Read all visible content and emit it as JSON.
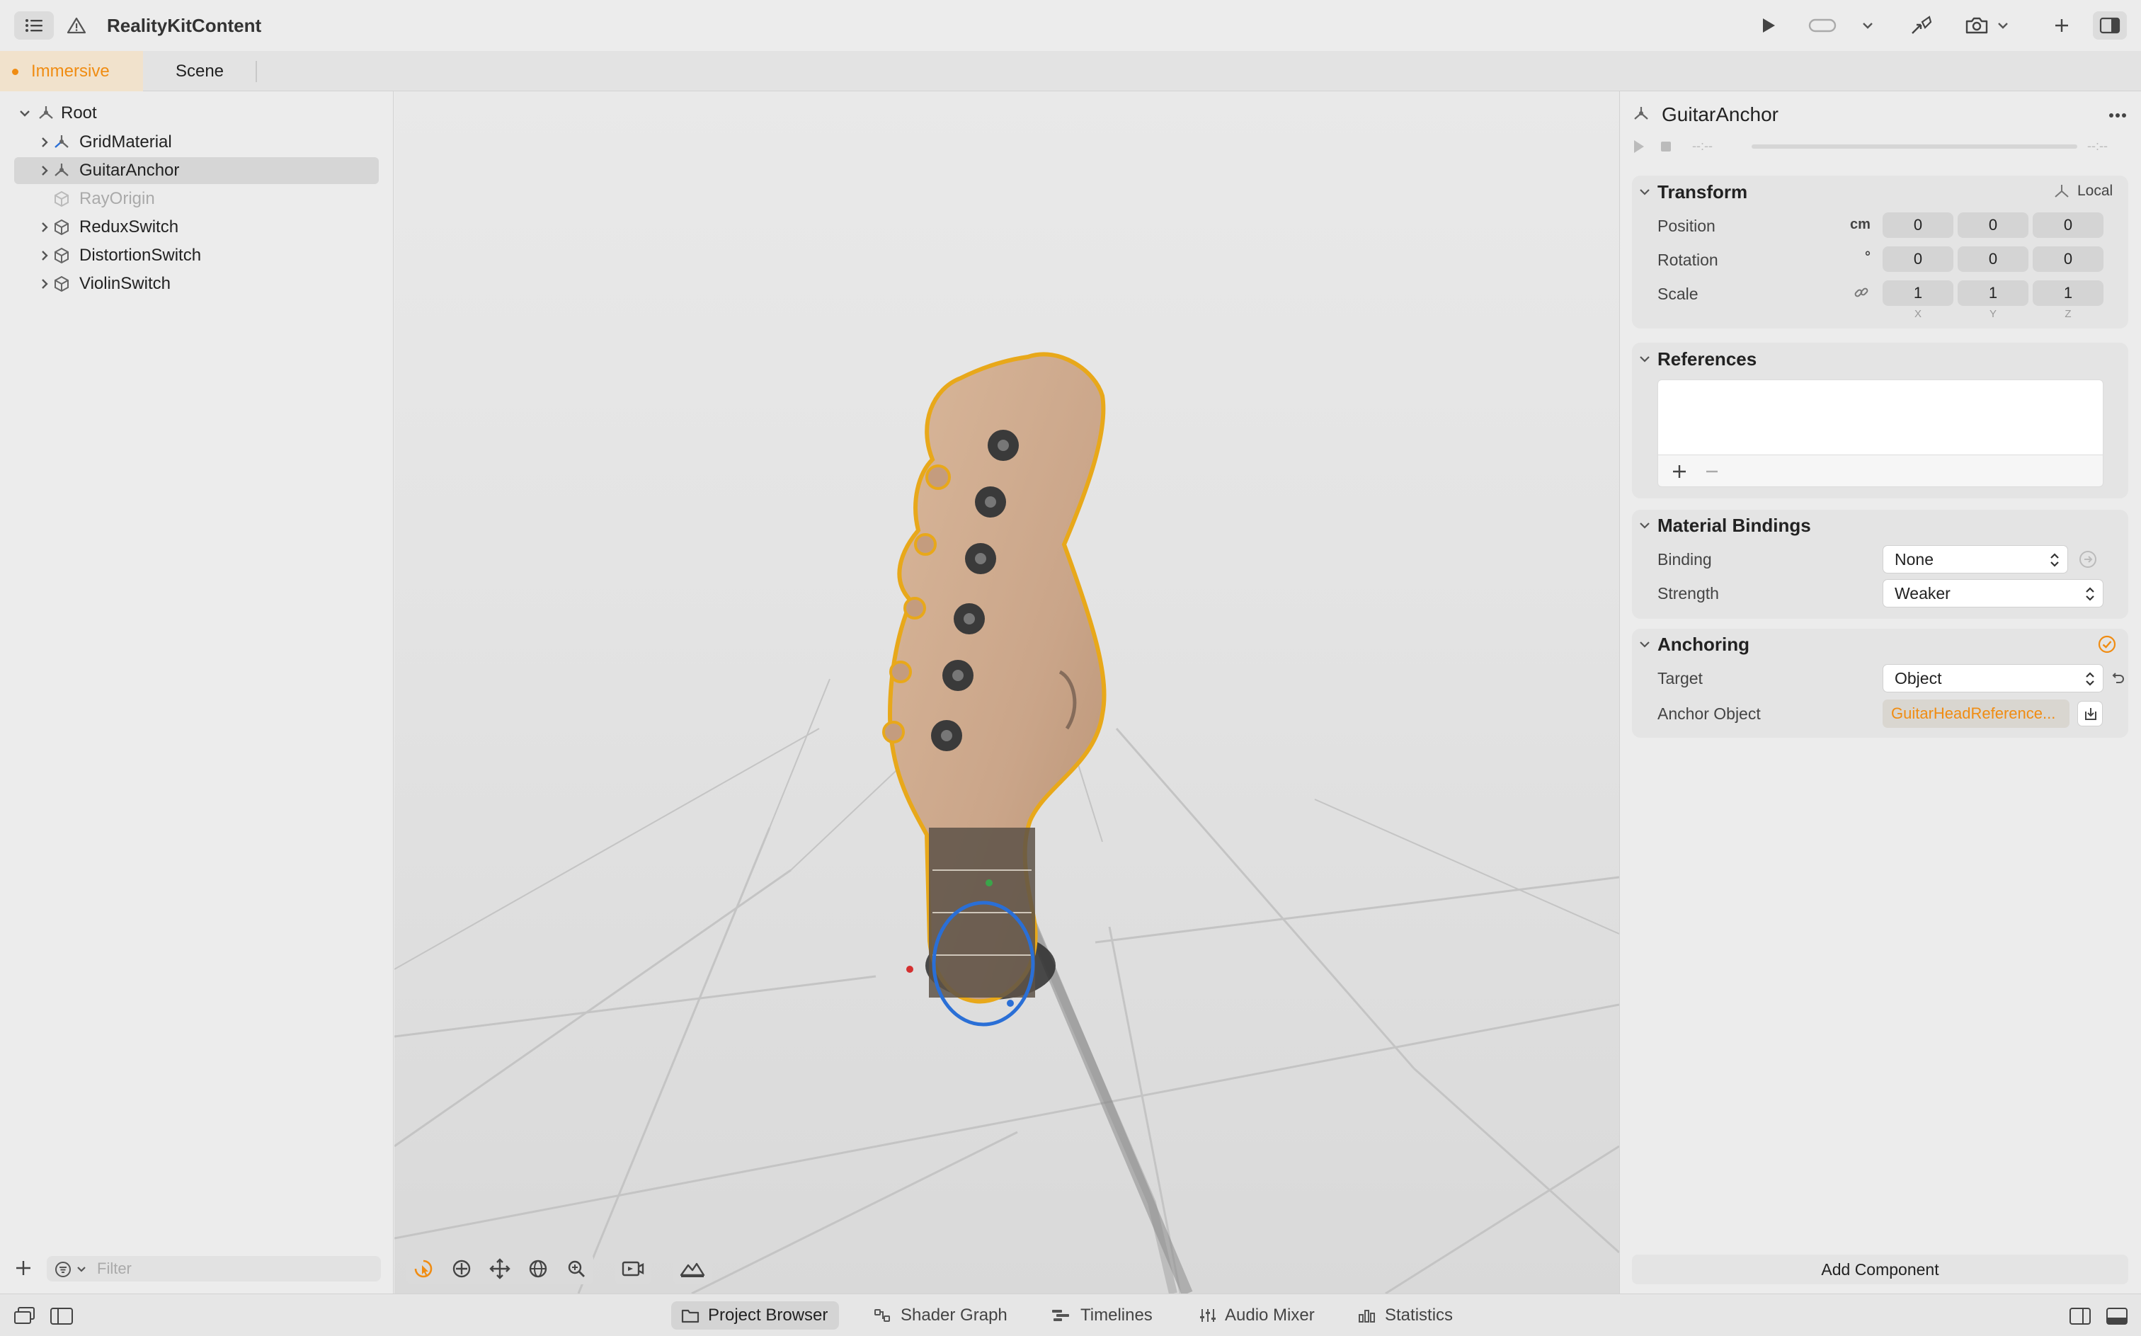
{
  "app": {
    "title": "RealityKitContent"
  },
  "tabs": [
    {
      "label": "Immersive",
      "modified": true,
      "active": true
    },
    {
      "label": "Scene",
      "active": false
    }
  ],
  "hierarchy": {
    "items": [
      {
        "label": "Root",
        "expanded": true,
        "kind": "anchor",
        "selected": false,
        "dimmed": false
      },
      {
        "label": "GridMaterial",
        "expanded": false,
        "kind": "anchor",
        "selected": false,
        "dimmed": false
      },
      {
        "label": "GuitarAnchor",
        "expanded": false,
        "kind": "anchor",
        "selected": true,
        "dimmed": false
      },
      {
        "label": "RayOrigin",
        "expanded": false,
        "kind": "entity",
        "selected": false,
        "dimmed": true
      },
      {
        "label": "ReduxSwitch",
        "expanded": false,
        "kind": "entity",
        "selected": false,
        "dimmed": false
      },
      {
        "label": "DistortionSwitch",
        "expanded": false,
        "kind": "entity",
        "selected": false,
        "dimmed": false
      },
      {
        "label": "ViolinSwitch",
        "expanded": false,
        "kind": "entity",
        "selected": false,
        "dimmed": false
      }
    ],
    "filter_placeholder": "Filter"
  },
  "inspector": {
    "title": "GuitarAnchor",
    "timeline": {
      "start": "--:--",
      "end": "--:--"
    },
    "transform": {
      "title": "Transform",
      "space": "Local",
      "position": {
        "label": "Position",
        "unit": "cm",
        "x": "0",
        "y": "0",
        "z": "0"
      },
      "rotation": {
        "label": "Rotation",
        "unit": "°",
        "x": "0",
        "y": "0",
        "z": "0"
      },
      "scale": {
        "label": "Scale",
        "x": "1",
        "y": "1",
        "z": "1"
      },
      "axes": {
        "x": "X",
        "y": "Y",
        "z": "Z"
      }
    },
    "references": {
      "title": "References"
    },
    "material_bindings": {
      "title": "Material Bindings",
      "binding_label": "Binding",
      "binding_value": "None",
      "strength_label": "Strength",
      "strength_value": "Weaker"
    },
    "anchoring": {
      "title": "Anchoring",
      "target_label": "Target",
      "target_value": "Object",
      "anchor_object_label": "Anchor Object",
      "anchor_object_value": "GuitarHeadReference..."
    },
    "add_component": "Add Component"
  },
  "bottom_tabs": [
    {
      "label": "Project Browser",
      "icon": "folder-icon",
      "active": true
    },
    {
      "label": "Shader Graph",
      "icon": "shader-graph-icon",
      "active": false
    },
    {
      "label": "Timelines",
      "icon": "timelines-icon",
      "active": false
    },
    {
      "label": "Audio Mixer",
      "icon": "audio-mixer-icon",
      "active": false
    },
    {
      "label": "Statistics",
      "icon": "statistics-icon",
      "active": false
    }
  ],
  "colors": {
    "accent": "#f08c12",
    "selection_outline": "#e8a81a",
    "gizmo": "#2a6fd6"
  }
}
